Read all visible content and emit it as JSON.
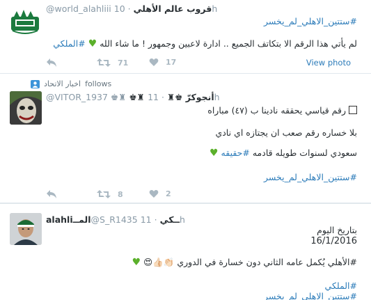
{
  "tweet1": {
    "name": "قروب عالم الأهلي",
    "handle": "@world_alahliii",
    "time": "10h",
    "hashtag_top": "#ستتين_الاهلي_لم_يخسر",
    "text": "لم يأتي هذا الرقم الا بتكاتف الجميع .. ادارة لاعبين وجمهور ! ما شاء الله",
    "hashtag_bottom": "#الملكي",
    "retweets": "71",
    "likes": "17",
    "view_photo": "View photo"
  },
  "tweet2": {
    "follows_label": "follows",
    "follows_account": "اخبار الاتحاد",
    "name": "♚♜ أنجوكرّ ♚♜",
    "handle": "@VITOR_1937 ♚♜",
    "time": "11h",
    "line1": "رقم قياسي يحققه نادينا ب (٤٧) مباراه",
    "line2": "بلا خساره رقم صعب ان يجتازه اي نادي",
    "line3": "سعودي لسنوات طويله قادمه",
    "line3_tag": "#حقيقه",
    "hashtag_bottom": "#ستتين_الاهلي_لم_يخسر",
    "retweets": "8",
    "likes": "2"
  },
  "tweet3": {
    "name": "alahliالمــ",
    "handle": "@S_R1435",
    "name_suffix": "ــكي",
    "time": "11h",
    "line1": "بتاريخ اليوم",
    "date": "16/1/2016",
    "line2": "#الأهلي يُكمل عامه الثاني دون خسارة في الدوري",
    "emojis": "👏🏻👍🏻😍",
    "hashtag1": "#الملكي",
    "hashtag2": "#ستتين_الاهلي_لم_يخسر"
  },
  "colors": {
    "link": "#2b7bb9",
    "muted": "#8899a6",
    "heart_green": "#5bb02b"
  },
  "icons": [
    "reply-icon",
    "retweet-icon",
    "like-icon",
    "follow-badge-icon",
    "square-emoji-icon",
    "green-heart-icon"
  ]
}
